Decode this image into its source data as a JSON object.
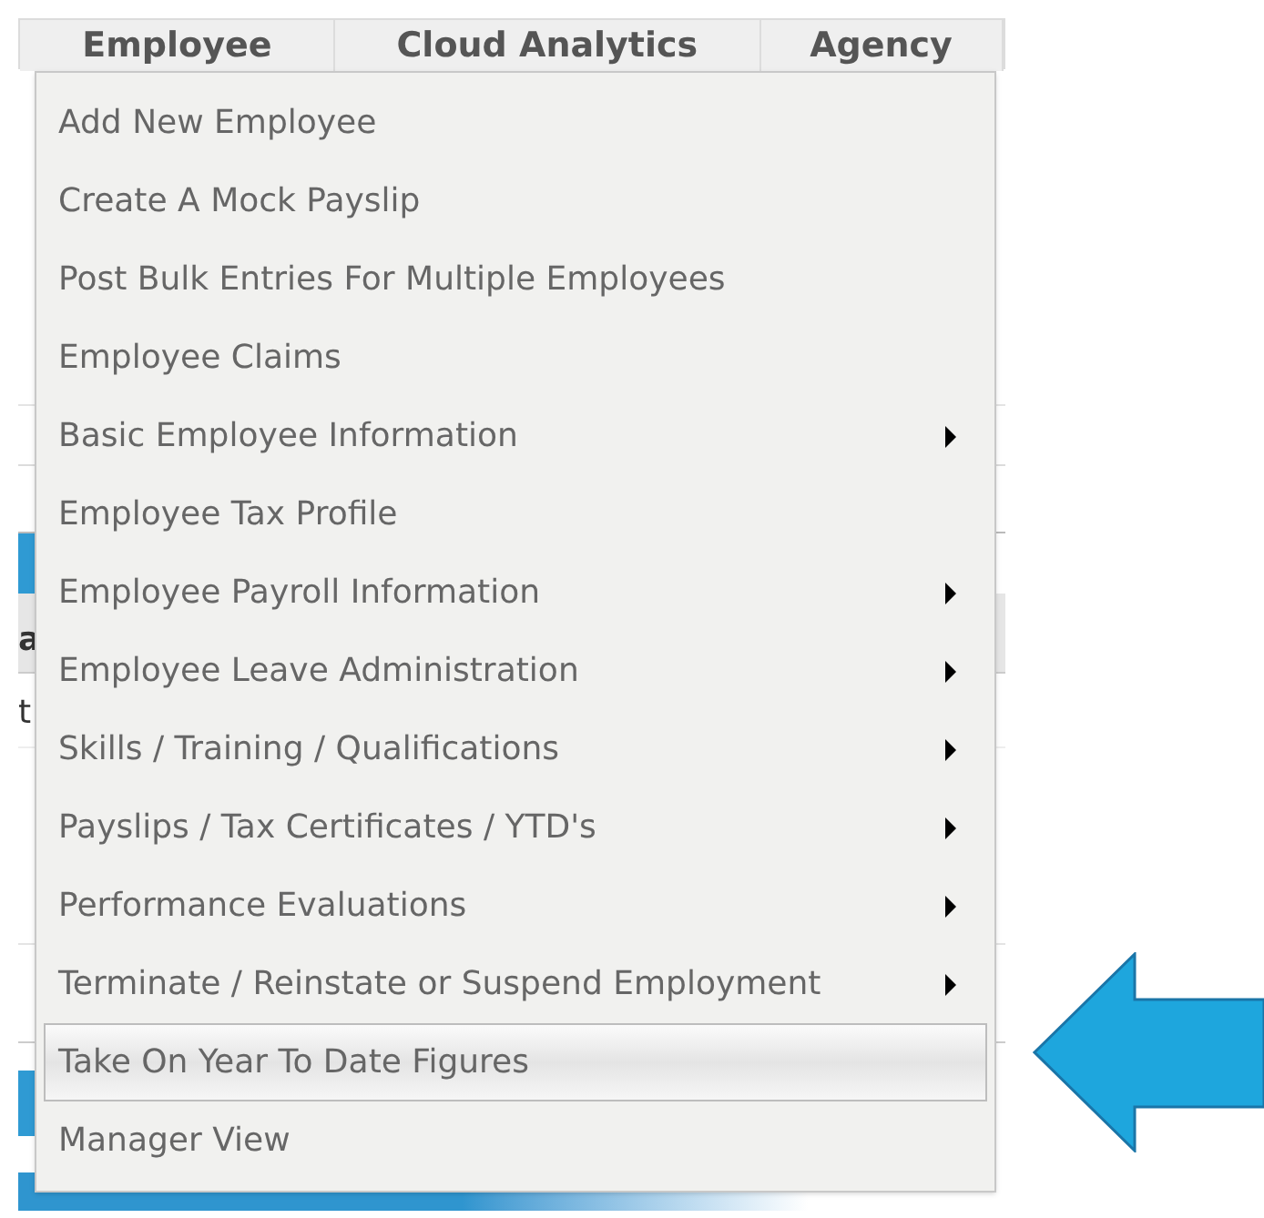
{
  "tabs": [
    {
      "label": "Employee"
    },
    {
      "label": "Cloud Analytics"
    },
    {
      "label": "Agency"
    }
  ],
  "background_fragments": [
    {
      "text": "a",
      "kind": "header-left"
    },
    {
      "text": "t",
      "kind": "row"
    }
  ],
  "menu": {
    "items": [
      {
        "label": "Add New Employee",
        "has_submenu": false,
        "selected": false
      },
      {
        "label": "Create A Mock Payslip",
        "has_submenu": false,
        "selected": false
      },
      {
        "label": "Post Bulk Entries For Multiple Employees",
        "has_submenu": false,
        "selected": false
      },
      {
        "label": "Employee Claims",
        "has_submenu": false,
        "selected": false
      },
      {
        "label": "Basic Employee Information",
        "has_submenu": true,
        "selected": false
      },
      {
        "label": "Employee Tax Profile",
        "has_submenu": false,
        "selected": false
      },
      {
        "label": "Employee Payroll Information",
        "has_submenu": true,
        "selected": false
      },
      {
        "label": "Employee Leave Administration",
        "has_submenu": true,
        "selected": false
      },
      {
        "label": "Skills / Training / Qualifications",
        "has_submenu": true,
        "selected": false
      },
      {
        "label": "Payslips / Tax Certificates / YTD's",
        "has_submenu": true,
        "selected": false
      },
      {
        "label": "Performance Evaluations",
        "has_submenu": true,
        "selected": false
      },
      {
        "label": "Terminate / Reinstate or Suspend Employment",
        "has_submenu": true,
        "selected": false
      },
      {
        "label": "Take On Year To Date Figures",
        "has_submenu": false,
        "selected": true
      },
      {
        "label": "Manager View",
        "has_submenu": false,
        "selected": false
      }
    ]
  }
}
